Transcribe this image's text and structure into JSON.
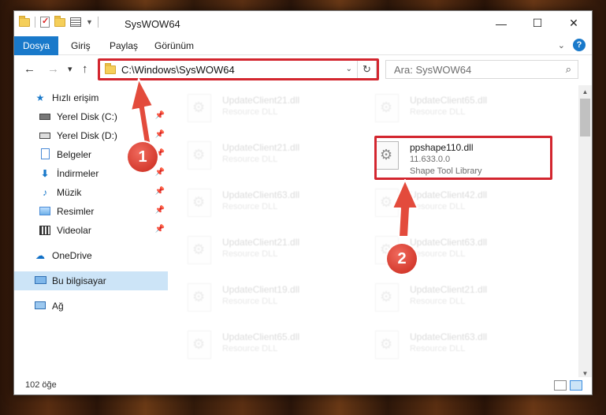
{
  "window": {
    "title": "SysWOW64",
    "controls": {
      "minimize": "—",
      "maximize": "☐",
      "close": "✕"
    }
  },
  "ribbon": {
    "tabs": [
      "Dosya",
      "Giriş",
      "Paylaş",
      "Görünüm"
    ],
    "help": "?"
  },
  "nav": {
    "back": "←",
    "forward": "→",
    "recent": "▾",
    "up": "↑",
    "address": "C:\\Windows\\SysWOW64",
    "refresh": "↻",
    "search_placeholder": "Ara: SysWOW64",
    "search_icon": "⌕"
  },
  "sidebar": {
    "items": [
      {
        "label": "Hızlı erişim",
        "icon": "star-icon"
      },
      {
        "label": "Yerel Disk (C:)",
        "icon": "drive-icon",
        "pinned": true
      },
      {
        "label": "Yerel Disk (D:)",
        "icon": "drive-icon",
        "pinned": true
      },
      {
        "label": "Belgeler",
        "icon": "document-icon",
        "pinned": true
      },
      {
        "label": "İndirmeler",
        "icon": "download-icon",
        "pinned": true
      },
      {
        "label": "Müzik",
        "icon": "music-icon",
        "pinned": true
      },
      {
        "label": "Resimler",
        "icon": "pictures-icon",
        "pinned": true
      },
      {
        "label": "Videolar",
        "icon": "videos-icon",
        "pinned": true
      },
      {
        "label": "OneDrive",
        "icon": "cloud-icon"
      },
      {
        "label": "Bu bilgisayar",
        "icon": "computer-icon",
        "selected": true
      },
      {
        "label": "Ağ",
        "icon": "network-icon"
      }
    ]
  },
  "files": [
    {
      "name": "UpdateClient21.dll",
      "desc": "Resource DLL"
    },
    {
      "name": "UpdateClient65.dll",
      "desc": "Resource DLL"
    },
    {
      "name": "UpdateClient21.dll",
      "desc": "Resource DLL"
    },
    {
      "name": "ppshape110.dll",
      "version": "11.633.0.0",
      "desc": "Shape Tool Library"
    },
    {
      "name": "UpdateClient63.dll",
      "desc": "Resource DLL"
    },
    {
      "name": "UpdateClient42.dll",
      "desc": "Resource DLL"
    },
    {
      "name": "UpdateClient21.dll",
      "desc": "Resource DLL"
    },
    {
      "name": "UpdateClient63.dll",
      "desc": "Resource DLL"
    },
    {
      "name": "UpdateClient19.dll",
      "desc": "Resource DLL"
    },
    {
      "name": "UpdateClient21.dll",
      "desc": "Resource DLL"
    },
    {
      "name": "UpdateClient65.dll",
      "desc": "Resource DLL"
    },
    {
      "name": "UpdateClient63.dll",
      "desc": "Resource DLL"
    }
  ],
  "status": {
    "count": "102 öğe"
  },
  "annotations": {
    "step1": "1",
    "step2": "2",
    "color": "#d3262f"
  }
}
